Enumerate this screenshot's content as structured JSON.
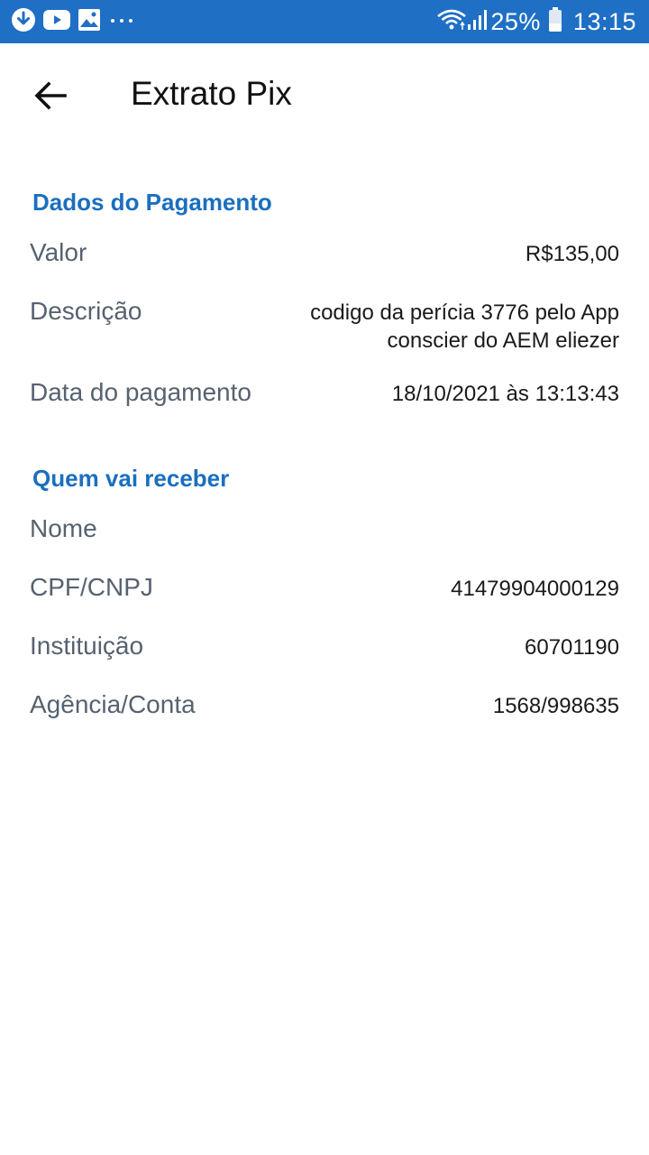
{
  "status_bar": {
    "icons_left": [
      "download-icon",
      "youtube-icon",
      "gallery-icon",
      "more-dots-icon"
    ],
    "battery": "25%",
    "time": "13:15"
  },
  "header": {
    "title": "Extrato Pix"
  },
  "payment_section": {
    "title": "Dados do Pagamento",
    "rows": [
      {
        "label": "Valor",
        "value": "R$135,00"
      },
      {
        "label": "Descrição",
        "value_line1": "codigo da perícia 3776 pelo App",
        "value_line2": "conscier do AEM eliezer"
      },
      {
        "label": "Data do pagamento",
        "value": "18/10/2021 às 13:13:43"
      }
    ]
  },
  "receiver_section": {
    "title": "Quem vai receber",
    "rows": [
      {
        "label": "Nome",
        "value": ""
      },
      {
        "label": "CPF/CNPJ",
        "value": "41479904000129"
      },
      {
        "label": "Instituição",
        "value": "60701190"
      },
      {
        "label": "Agência/Conta",
        "value": "1568/998635"
      }
    ]
  },
  "colors": {
    "status_bar": "#1f6fc5",
    "section_title": "#1a6fbf",
    "label": "#566270"
  }
}
